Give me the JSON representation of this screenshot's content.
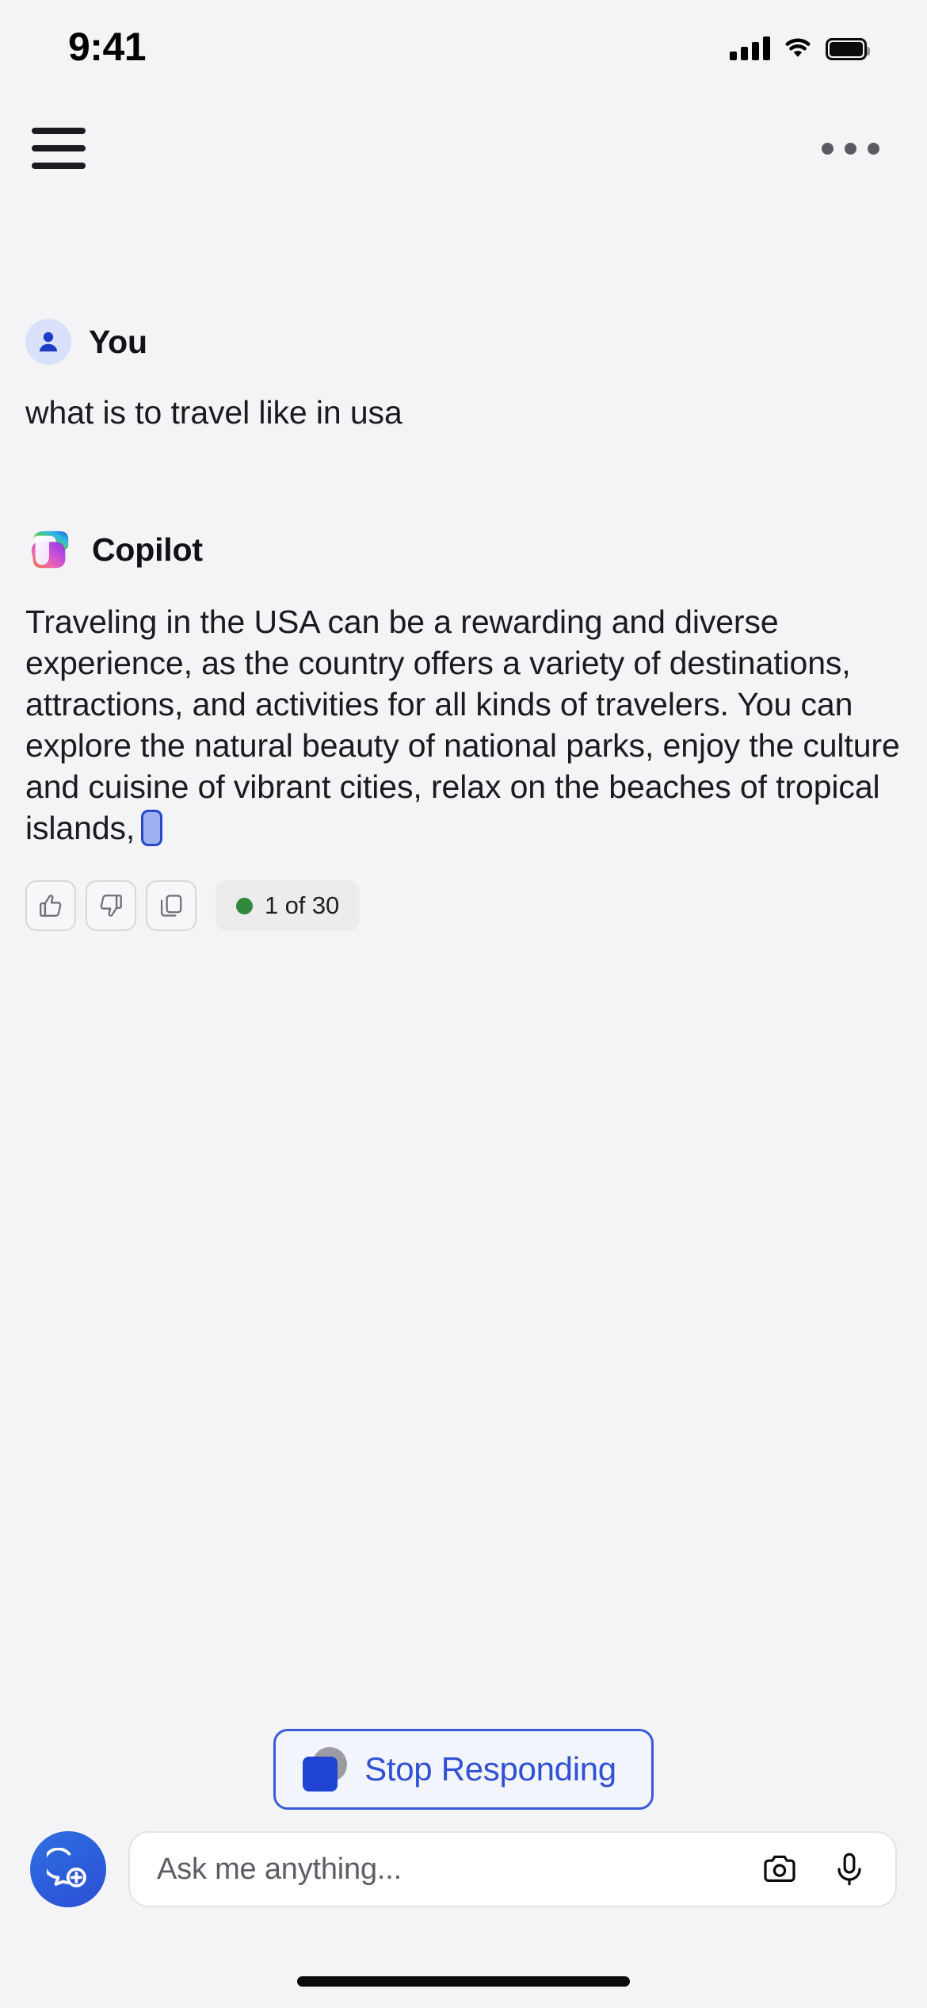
{
  "status_bar": {
    "time": "9:41",
    "signal_icon": "cellular-signal-icon",
    "wifi_icon": "wifi-icon",
    "battery_icon": "battery-full-icon"
  },
  "nav_bar": {
    "menu_icon": "hamburger-menu-icon",
    "more_icon": "more-options-icon"
  },
  "conversation": [
    {
      "role": "user",
      "sender": "You",
      "avatar_icon": "person-avatar-icon",
      "text": "what is to travel like in usa"
    },
    {
      "role": "assistant",
      "sender": "Copilot",
      "avatar_icon": "copilot-logo-icon",
      "text": "Traveling in the USA can be a rewarding and diverse experience, as the country offers a variety of destinations, attractions, and activities for all kinds of travelers. You can explore the natural beauty of national parks, enjoy the culture and cuisine of vibrant cities, relax on the beaches of tropical islands,",
      "streaming": true,
      "actions": [
        {
          "name": "thumbs-up",
          "icon": "thumbs-up-icon"
        },
        {
          "name": "thumbs-down",
          "icon": "thumbs-down-icon"
        },
        {
          "name": "copy",
          "icon": "copy-icon"
        }
      ],
      "counter": {
        "text": "1 of 30",
        "status_dot_color": "#2f8a3e"
      }
    }
  ],
  "stop_button": {
    "label": "Stop Responding",
    "icon": "stop-square-icon",
    "accent_color": "#3250d4",
    "border_color": "#3b5ad8",
    "background_color": "#f2f4fe"
  },
  "composer": {
    "new_chat_icon": "new-chat-bubble-plus-icon",
    "placeholder": "Ask me anything...",
    "camera_icon": "camera-icon",
    "mic_icon": "microphone-icon"
  },
  "colors": {
    "page_background": "#f4f4f6",
    "user_avatar_background": "#d9e1fa",
    "user_avatar_glyph": "#1c3cc4",
    "new_chat_button": "#2a4fd6",
    "cursor_fill": "#9db0ef",
    "cursor_border": "#2747c9"
  }
}
